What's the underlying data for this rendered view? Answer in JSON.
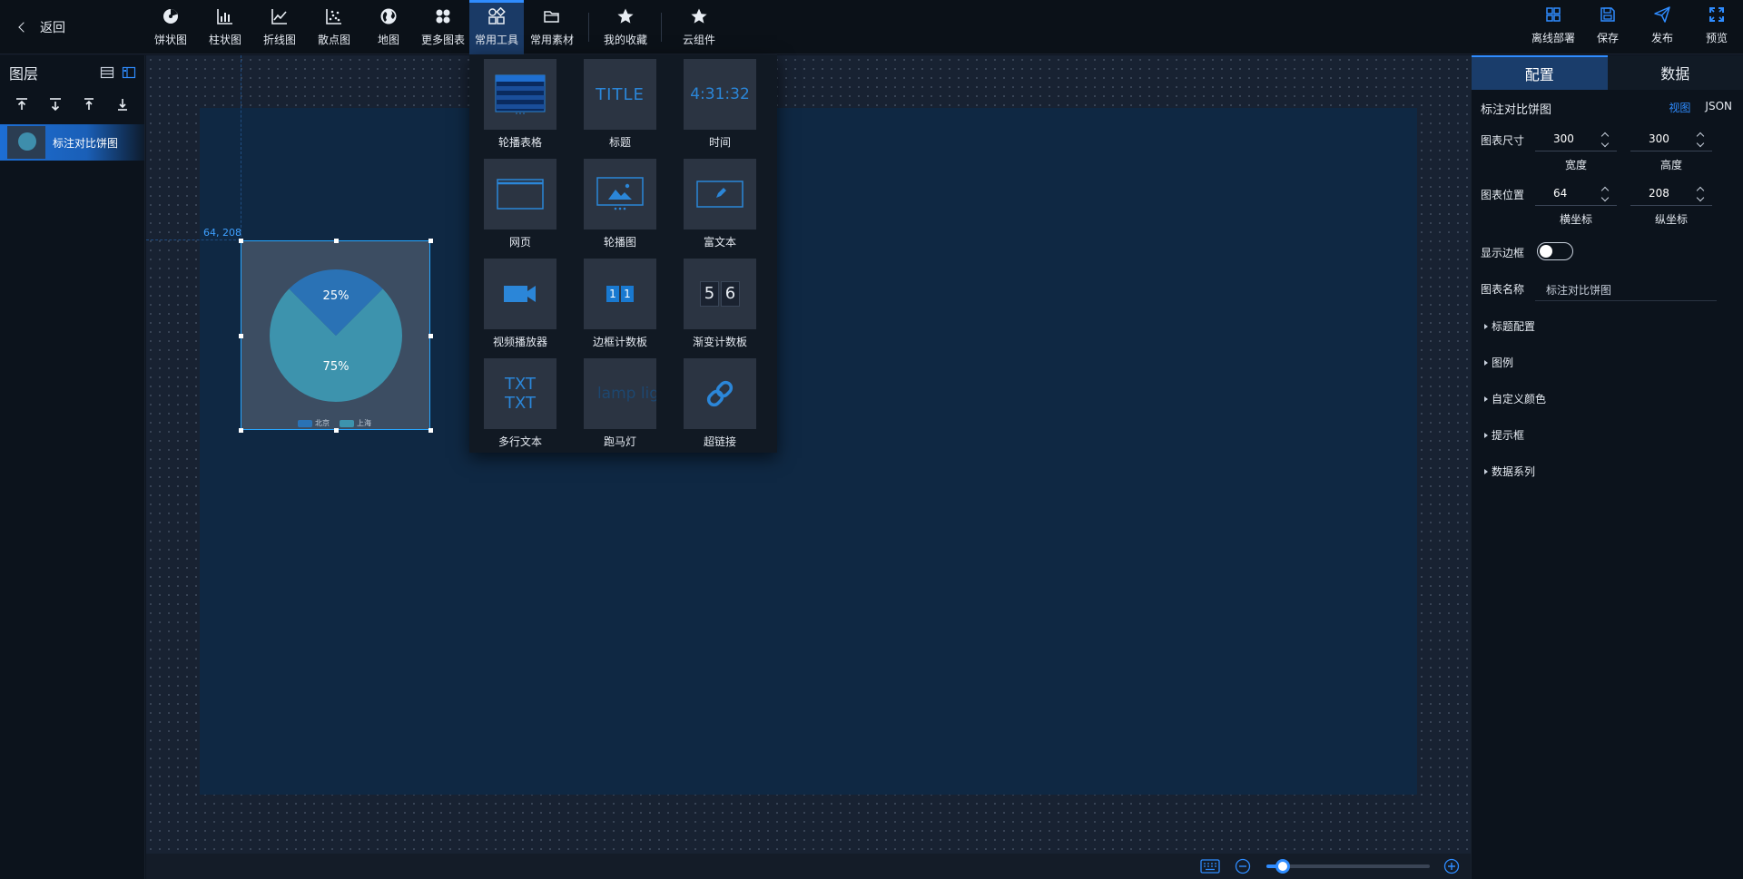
{
  "topbar": {
    "back_label": "返回",
    "tools": [
      {
        "label": "饼状图",
        "icon": "pie-chart-icon"
      },
      {
        "label": "柱状图",
        "icon": "bar-chart-icon"
      },
      {
        "label": "折线图",
        "icon": "line-chart-icon"
      },
      {
        "label": "散点图",
        "icon": "scatter-chart-icon"
      },
      {
        "label": "地图",
        "icon": "globe-icon"
      },
      {
        "label": "更多图表",
        "icon": "more-charts-icon"
      },
      {
        "label": "常用工具",
        "icon": "tools-grid-icon",
        "active": true
      },
      {
        "label": "常用素材",
        "icon": "folder-icon"
      },
      {
        "label": "我的收藏",
        "icon": "star-icon"
      },
      {
        "label": "云组件",
        "icon": "star-icon"
      }
    ],
    "actions": [
      {
        "label": "离线部署",
        "icon": "grid-icon"
      },
      {
        "label": "保存",
        "icon": "save-icon"
      },
      {
        "label": "发布",
        "icon": "send-icon"
      },
      {
        "label": "预览",
        "icon": "fullscreen-icon"
      }
    ]
  },
  "layers": {
    "title": "图层",
    "items": [
      {
        "name": "标注对比饼图"
      }
    ]
  },
  "widget": {
    "coord_label": "64, 208",
    "slices": [
      {
        "label": "25%",
        "value": 25,
        "color": "#2a72b5"
      },
      {
        "label": "75%",
        "value": 75,
        "color": "#3d93ad"
      }
    ],
    "legend": [
      {
        "name": "北京",
        "color": "#2a72b5"
      },
      {
        "name": "上海",
        "color": "#3d93ad"
      }
    ]
  },
  "dropdown": {
    "items": [
      {
        "label": "轮播表格",
        "icon": "carousel-table-icon"
      },
      {
        "label": "标题",
        "icon": "title-icon",
        "text": "TITLE"
      },
      {
        "label": "时间",
        "icon": "time-icon",
        "text": "4:31:32"
      },
      {
        "label": "网页",
        "icon": "webpage-icon"
      },
      {
        "label": "轮播图",
        "icon": "image-carousel-icon"
      },
      {
        "label": "富文本",
        "icon": "rich-text-icon"
      },
      {
        "label": "视频播放器",
        "icon": "video-camera-icon"
      },
      {
        "label": "边框计数板",
        "icon": "border-counter-icon",
        "digits": [
          "1",
          "1"
        ]
      },
      {
        "label": "渐变计数板",
        "icon": "gradient-counter-icon",
        "digits": [
          "5",
          "6"
        ]
      },
      {
        "label": "多行文本",
        "icon": "multiline-text-icon",
        "text": "TXT TXT"
      },
      {
        "label": "跑马灯",
        "icon": "marquee-icon",
        "text": "lamp lig"
      },
      {
        "label": "超链接",
        "icon": "link-icon"
      }
    ]
  },
  "zoom": {
    "level": 0.1
  },
  "config": {
    "tabs": [
      "配置",
      "数据"
    ],
    "chart_title": "标注对比饼图",
    "view_label": "视图",
    "json_label": "JSON",
    "size_label": "图表尺寸",
    "width": {
      "value": "300",
      "label": "宽度"
    },
    "height": {
      "value": "300",
      "label": "高度"
    },
    "position_label": "图表位置",
    "x": {
      "value": "64",
      "label": "横坐标"
    },
    "y": {
      "value": "208",
      "label": "纵坐标"
    },
    "border_label": "显示边框",
    "border_on": false,
    "name_label": "图表名称",
    "name_value": "标注对比饼图",
    "sections": [
      "标题配置",
      "图例",
      "自定义颜色",
      "提示框",
      "数据系列"
    ]
  }
}
